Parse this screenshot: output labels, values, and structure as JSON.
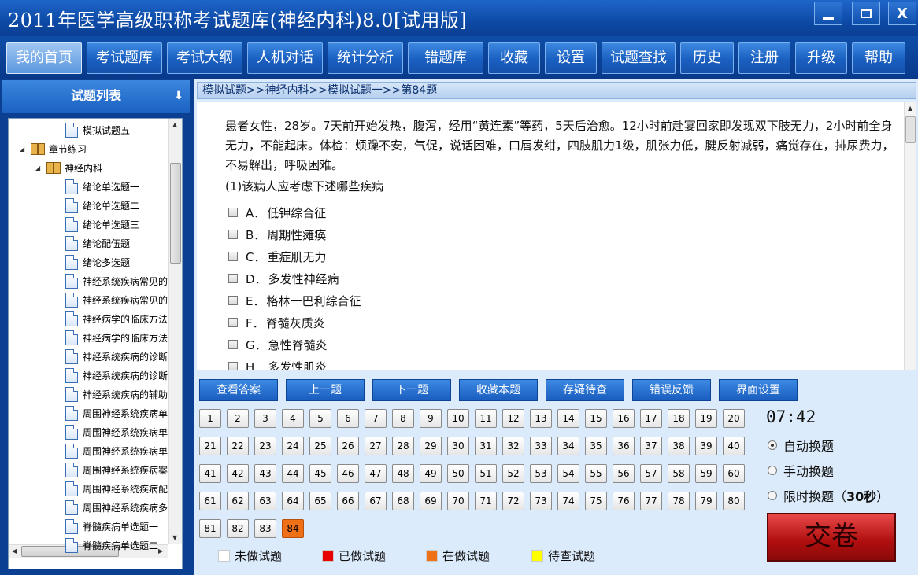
{
  "window": {
    "title": "2011年医学高级职称考试题库(神经内科)8.0[试用版]",
    "min_glyph": "minimize-icon",
    "max_glyph": "maximize-icon",
    "close_label": "X"
  },
  "menu": [
    {
      "label": "我的首页",
      "active": true
    },
    {
      "label": "考试题库"
    },
    {
      "label": "考试大纲"
    },
    {
      "label": "人机对话"
    },
    {
      "label": "统计分析"
    },
    {
      "label": "错题库"
    },
    {
      "label": "收藏"
    },
    {
      "label": "设置"
    },
    {
      "label": "试题查找"
    },
    {
      "label": "历史"
    },
    {
      "label": "注册"
    },
    {
      "label": "升级"
    },
    {
      "label": "帮助"
    }
  ],
  "sidebar": {
    "title": "试题列表",
    "collapse_icon": "double-chevron-down-icon",
    "tree": [
      {
        "label": "模拟试题五",
        "kind": "doc",
        "level": 3
      },
      {
        "label": "章节练习",
        "kind": "book",
        "level": 1
      },
      {
        "label": "神经内科",
        "kind": "book",
        "level": 2
      },
      {
        "label": "绪论单选题一",
        "kind": "doc",
        "level": 3
      },
      {
        "label": "绪论单选题二",
        "kind": "doc",
        "level": 3
      },
      {
        "label": "绪论单选题三",
        "kind": "doc",
        "level": 3
      },
      {
        "label": "绪论配伍题",
        "kind": "doc",
        "level": 3
      },
      {
        "label": "绪论多选题",
        "kind": "doc",
        "level": 3
      },
      {
        "label": "神经系统疾病常见的",
        "kind": "doc",
        "level": 3
      },
      {
        "label": "神经系统疾病常见的",
        "kind": "doc",
        "level": 3
      },
      {
        "label": "神经病学的临床方法",
        "kind": "doc",
        "level": 3
      },
      {
        "label": "神经病学的临床方法",
        "kind": "doc",
        "level": 3
      },
      {
        "label": "神经系统疾病的诊断",
        "kind": "doc",
        "level": 3
      },
      {
        "label": "神经系统疾病的诊断",
        "kind": "doc",
        "level": 3
      },
      {
        "label": "神经系统疾病的辅助",
        "kind": "doc",
        "level": 3
      },
      {
        "label": "周围神经系统疾病单",
        "kind": "doc",
        "level": 3
      },
      {
        "label": "周围神经系统疾病单",
        "kind": "doc",
        "level": 3
      },
      {
        "label": "周围神经系统疾病单",
        "kind": "doc",
        "level": 3
      },
      {
        "label": "周围神经系统疾病案",
        "kind": "doc",
        "level": 3
      },
      {
        "label": "周围神经系统疾病配",
        "kind": "doc",
        "level": 3
      },
      {
        "label": "周围神经系统疾病多",
        "kind": "doc",
        "level": 3
      },
      {
        "label": "脊髓疾病单选题一",
        "kind": "doc",
        "level": 3
      },
      {
        "label": "脊髓疾病单选题二",
        "kind": "doc",
        "level": 3
      }
    ]
  },
  "breadcrumb": "模拟试题>>神经内科>>模拟试题一>>第84题",
  "question": {
    "stem": "患者女性，28岁。7天前开始发热，腹泻，经用“黄连素”等药，5天后治愈。12小时前赴宴回家即发现双下肢无力，2小时前全身无力，不能起床。体检：烦躁不安，气促，说话困难，口唇发绀，四肢肌力1级，肌张力低，腱反射减弱，痛觉存在，排尿费力，不易解出，呼吸困难。",
    "sub": "(1)该病人应考虑下述哪些疾病",
    "options": [
      {
        "letter": "A．",
        "text": "低钾综合征"
      },
      {
        "letter": "B．",
        "text": "周期性瘫痪"
      },
      {
        "letter": "C．",
        "text": "重症肌无力"
      },
      {
        "letter": "D．",
        "text": "多发性神经病"
      },
      {
        "letter": "E．",
        "text": "格林一巴利综合征"
      },
      {
        "letter": "F．",
        "text": "脊髓灰质炎"
      },
      {
        "letter": "G．",
        "text": "急性脊髓炎"
      },
      {
        "letter": "H．",
        "text": "多发性肌炎"
      }
    ]
  },
  "actions": [
    "查看答案",
    "上一题",
    "下一题",
    "收藏本题",
    "存疑待查",
    "错误反馈",
    "界面设置"
  ],
  "numbers": [
    "1",
    "2",
    "3",
    "4",
    "5",
    "6",
    "7",
    "8",
    "9",
    "10",
    "11",
    "12",
    "13",
    "14",
    "15",
    "16",
    "17",
    "18",
    "19",
    "20",
    "21",
    "22",
    "23",
    "24",
    "25",
    "26",
    "27",
    "28",
    "29",
    "30",
    "31",
    "32",
    "33",
    "34",
    "35",
    "36",
    "37",
    "38",
    "39",
    "40",
    "41",
    "42",
    "43",
    "44",
    "45",
    "46",
    "47",
    "48",
    "49",
    "50",
    "51",
    "52",
    "53",
    "54",
    "55",
    "56",
    "57",
    "58",
    "59",
    "60",
    "61",
    "62",
    "63",
    "64",
    "65",
    "66",
    "67",
    "68",
    "69",
    "70",
    "71",
    "72",
    "73",
    "74",
    "75",
    "76",
    "77",
    "78",
    "79",
    "80",
    "81",
    "82",
    "83",
    "84"
  ],
  "current_number": "84",
  "timer": "07:42",
  "modes": [
    {
      "label": "自动换题",
      "selected": true
    },
    {
      "label": "手动换题",
      "selected": false
    },
    {
      "label": "限时换题（",
      "strong": "30秒",
      "suffix": "）",
      "selected": false
    }
  ],
  "submit_label": "交卷",
  "legend": [
    {
      "label": "未做试题",
      "color": "#ffffff"
    },
    {
      "label": "已做试题",
      "color": "#e60000"
    },
    {
      "label": "在做试题",
      "color": "#f07018"
    },
    {
      "label": "待查试题",
      "color": "#ffff00"
    }
  ]
}
